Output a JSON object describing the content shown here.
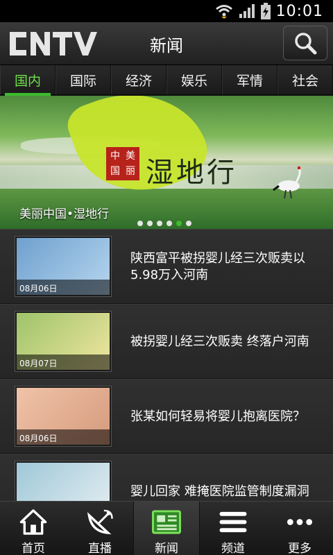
{
  "status_bar": {
    "time": "10:01"
  },
  "header": {
    "logo_text": "CNTV",
    "title": "新闻"
  },
  "tabs": [
    {
      "label": "国内",
      "active": true
    },
    {
      "label": "国际",
      "active": false
    },
    {
      "label": "经济",
      "active": false
    },
    {
      "label": "娱乐",
      "active": false
    },
    {
      "label": "军情",
      "active": false
    },
    {
      "label": "社会",
      "active": false
    }
  ],
  "banner": {
    "caption": "美丽中国•湿地行",
    "brand_chars": [
      "中",
      "美",
      "国",
      "丽"
    ],
    "calligraphy": "湿地行",
    "dots_total": 6,
    "dots_active_index": 4
  },
  "news": [
    {
      "date": "08月06日",
      "title": "陕西富平被拐婴儿经三次贩卖以5.98万入河南"
    },
    {
      "date": "08月07日",
      "title": "被拐婴儿经三次贩卖 终落户河南"
    },
    {
      "date": "08月06日",
      "title": "张某如何轻易将婴儿抱离医院？"
    },
    {
      "date": "",
      "title": "婴儿回家 难掩医院监管制度漏洞"
    }
  ],
  "bottom_nav": [
    {
      "label": "首页",
      "icon": "home-icon"
    },
    {
      "label": "直播",
      "icon": "satellite-icon"
    },
    {
      "label": "新闻",
      "icon": "news-icon",
      "active": true
    },
    {
      "label": "频道",
      "icon": "menu-icon"
    },
    {
      "label": "更多",
      "icon": "more-icon"
    }
  ],
  "colors": {
    "accent": "#3dbb2e",
    "active_tab_text": "#6fe14a"
  }
}
